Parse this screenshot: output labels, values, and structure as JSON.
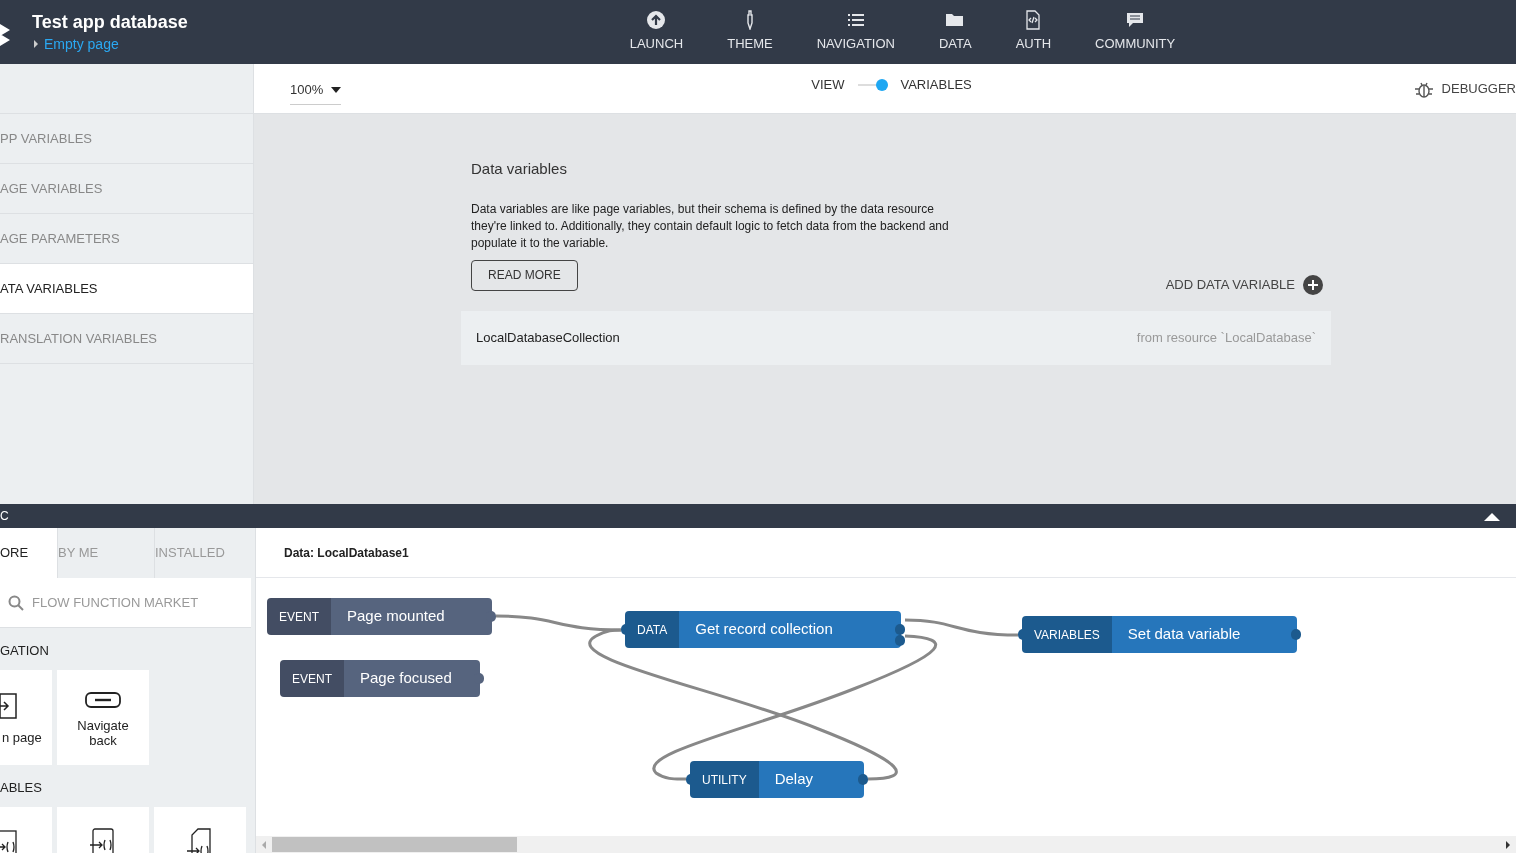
{
  "header": {
    "title": "Test app database",
    "page": "Empty page",
    "nav": [
      {
        "label": "LAUNCH"
      },
      {
        "label": "THEME"
      },
      {
        "label": "NAVIGATION"
      },
      {
        "label": "DATA"
      },
      {
        "label": "AUTH"
      },
      {
        "label": "COMMUNITY"
      }
    ]
  },
  "sidebar": {
    "items": [
      {
        "label": "PP VARIABLES",
        "selected": false
      },
      {
        "label": "AGE VARIABLES",
        "selected": false
      },
      {
        "label": "AGE PARAMETERS",
        "selected": false
      },
      {
        "label": "ATA VARIABLES",
        "selected": true
      },
      {
        "label": "RANSLATION VARIABLES",
        "selected": false
      }
    ]
  },
  "toolbar": {
    "zoom": "100%",
    "toggle": [
      {
        "label": "VIEW",
        "selected": false
      },
      {
        "label": "VARIABLES",
        "selected": true
      }
    ],
    "debugger": "DEBUGGER"
  },
  "content": {
    "title": "Data variables",
    "description": "Data variables are like page variables, but their schema is defined by the data resource they're linked to. Additionally, they contain default logic to fetch data from the backend and populate it to the variable.",
    "read_more": "READ MORE",
    "add": "ADD DATA VARIABLE",
    "rows": [
      {
        "name": "LocalDatabaseCollection",
        "source": "from resource `LocalDatabase`"
      }
    ]
  },
  "logic_bar": {
    "title": "C"
  },
  "market": {
    "tabs": [
      {
        "label": "ORE",
        "selected": true
      },
      {
        "label": "BY ME",
        "selected": false
      },
      {
        "label": "INSTALLED",
        "selected": false
      }
    ],
    "search": {
      "placeholder": "FLOW FUNCTION MARKET"
    },
    "sections": [
      {
        "title": "GATION",
        "tiles": [
          {
            "kind": "labeled",
            "label": "n page"
          },
          {
            "kind": "labeled",
            "label": "Navigate back"
          }
        ]
      },
      {
        "title": "ABLES",
        "tiles": [
          {
            "kind": "icon"
          },
          {
            "kind": "icon"
          },
          {
            "kind": "icon"
          }
        ]
      }
    ]
  },
  "flow": {
    "title": "Data: LocalDatabase1",
    "nodes": [
      {
        "kind": "event",
        "category": "EVENT",
        "label": "Page mounted"
      },
      {
        "kind": "event",
        "category": "EVENT",
        "label": "Page focused"
      },
      {
        "kind": "action",
        "category": "DATA",
        "label": "Get record collection"
      },
      {
        "kind": "action",
        "category": "VARIABLES",
        "label": "Set data variable"
      },
      {
        "kind": "action",
        "category": "UTILITY",
        "label": "Delay"
      }
    ]
  }
}
